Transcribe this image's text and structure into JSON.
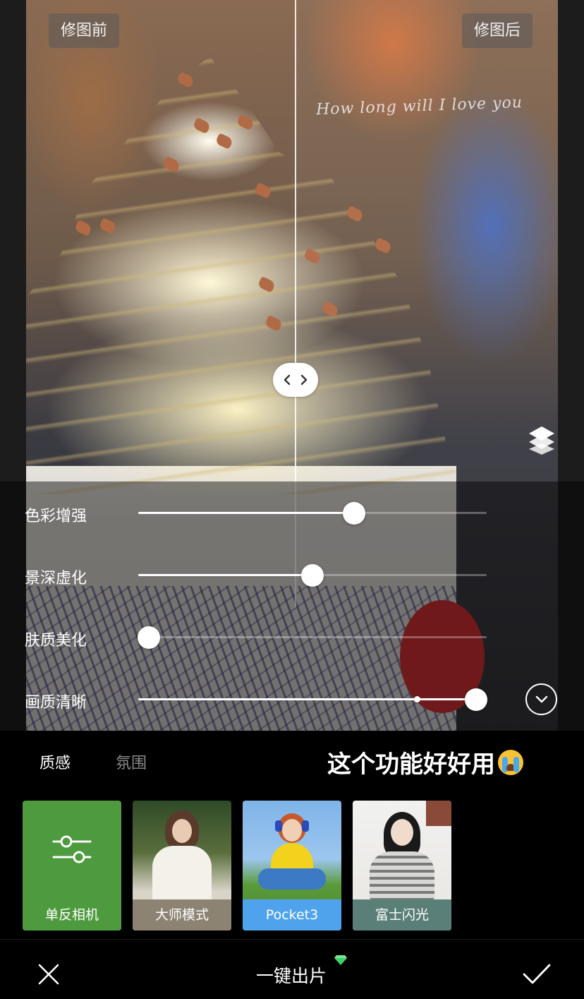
{
  "compare": {
    "before_label": "修图前",
    "after_label": "修图后",
    "handwriting": "How long will I love you"
  },
  "sliders": [
    {
      "label": "色彩增强",
      "value": 62
    },
    {
      "label": "景深虚化",
      "value": 50
    },
    {
      "label": "肤质美化",
      "value": 3
    },
    {
      "label": "画质清晰",
      "value": 97,
      "default_value": 80
    }
  ],
  "tabs": [
    {
      "label": "质感",
      "active": true
    },
    {
      "label": "氛围",
      "active": false
    }
  ],
  "overlay_caption": "这个功能好好用",
  "presets": [
    {
      "label": "单反相机",
      "selected": true
    },
    {
      "label": "大师模式",
      "selected": false
    },
    {
      "label": "Pocket3",
      "selected": false
    },
    {
      "label": "富士闪光",
      "selected": false
    }
  ],
  "bottom_bar": {
    "title": "一键出片"
  },
  "colors": {
    "accent_green": "#4e9a3e",
    "pocket_blue": "#4ea3ec",
    "gem_green": "#3fd16a"
  }
}
